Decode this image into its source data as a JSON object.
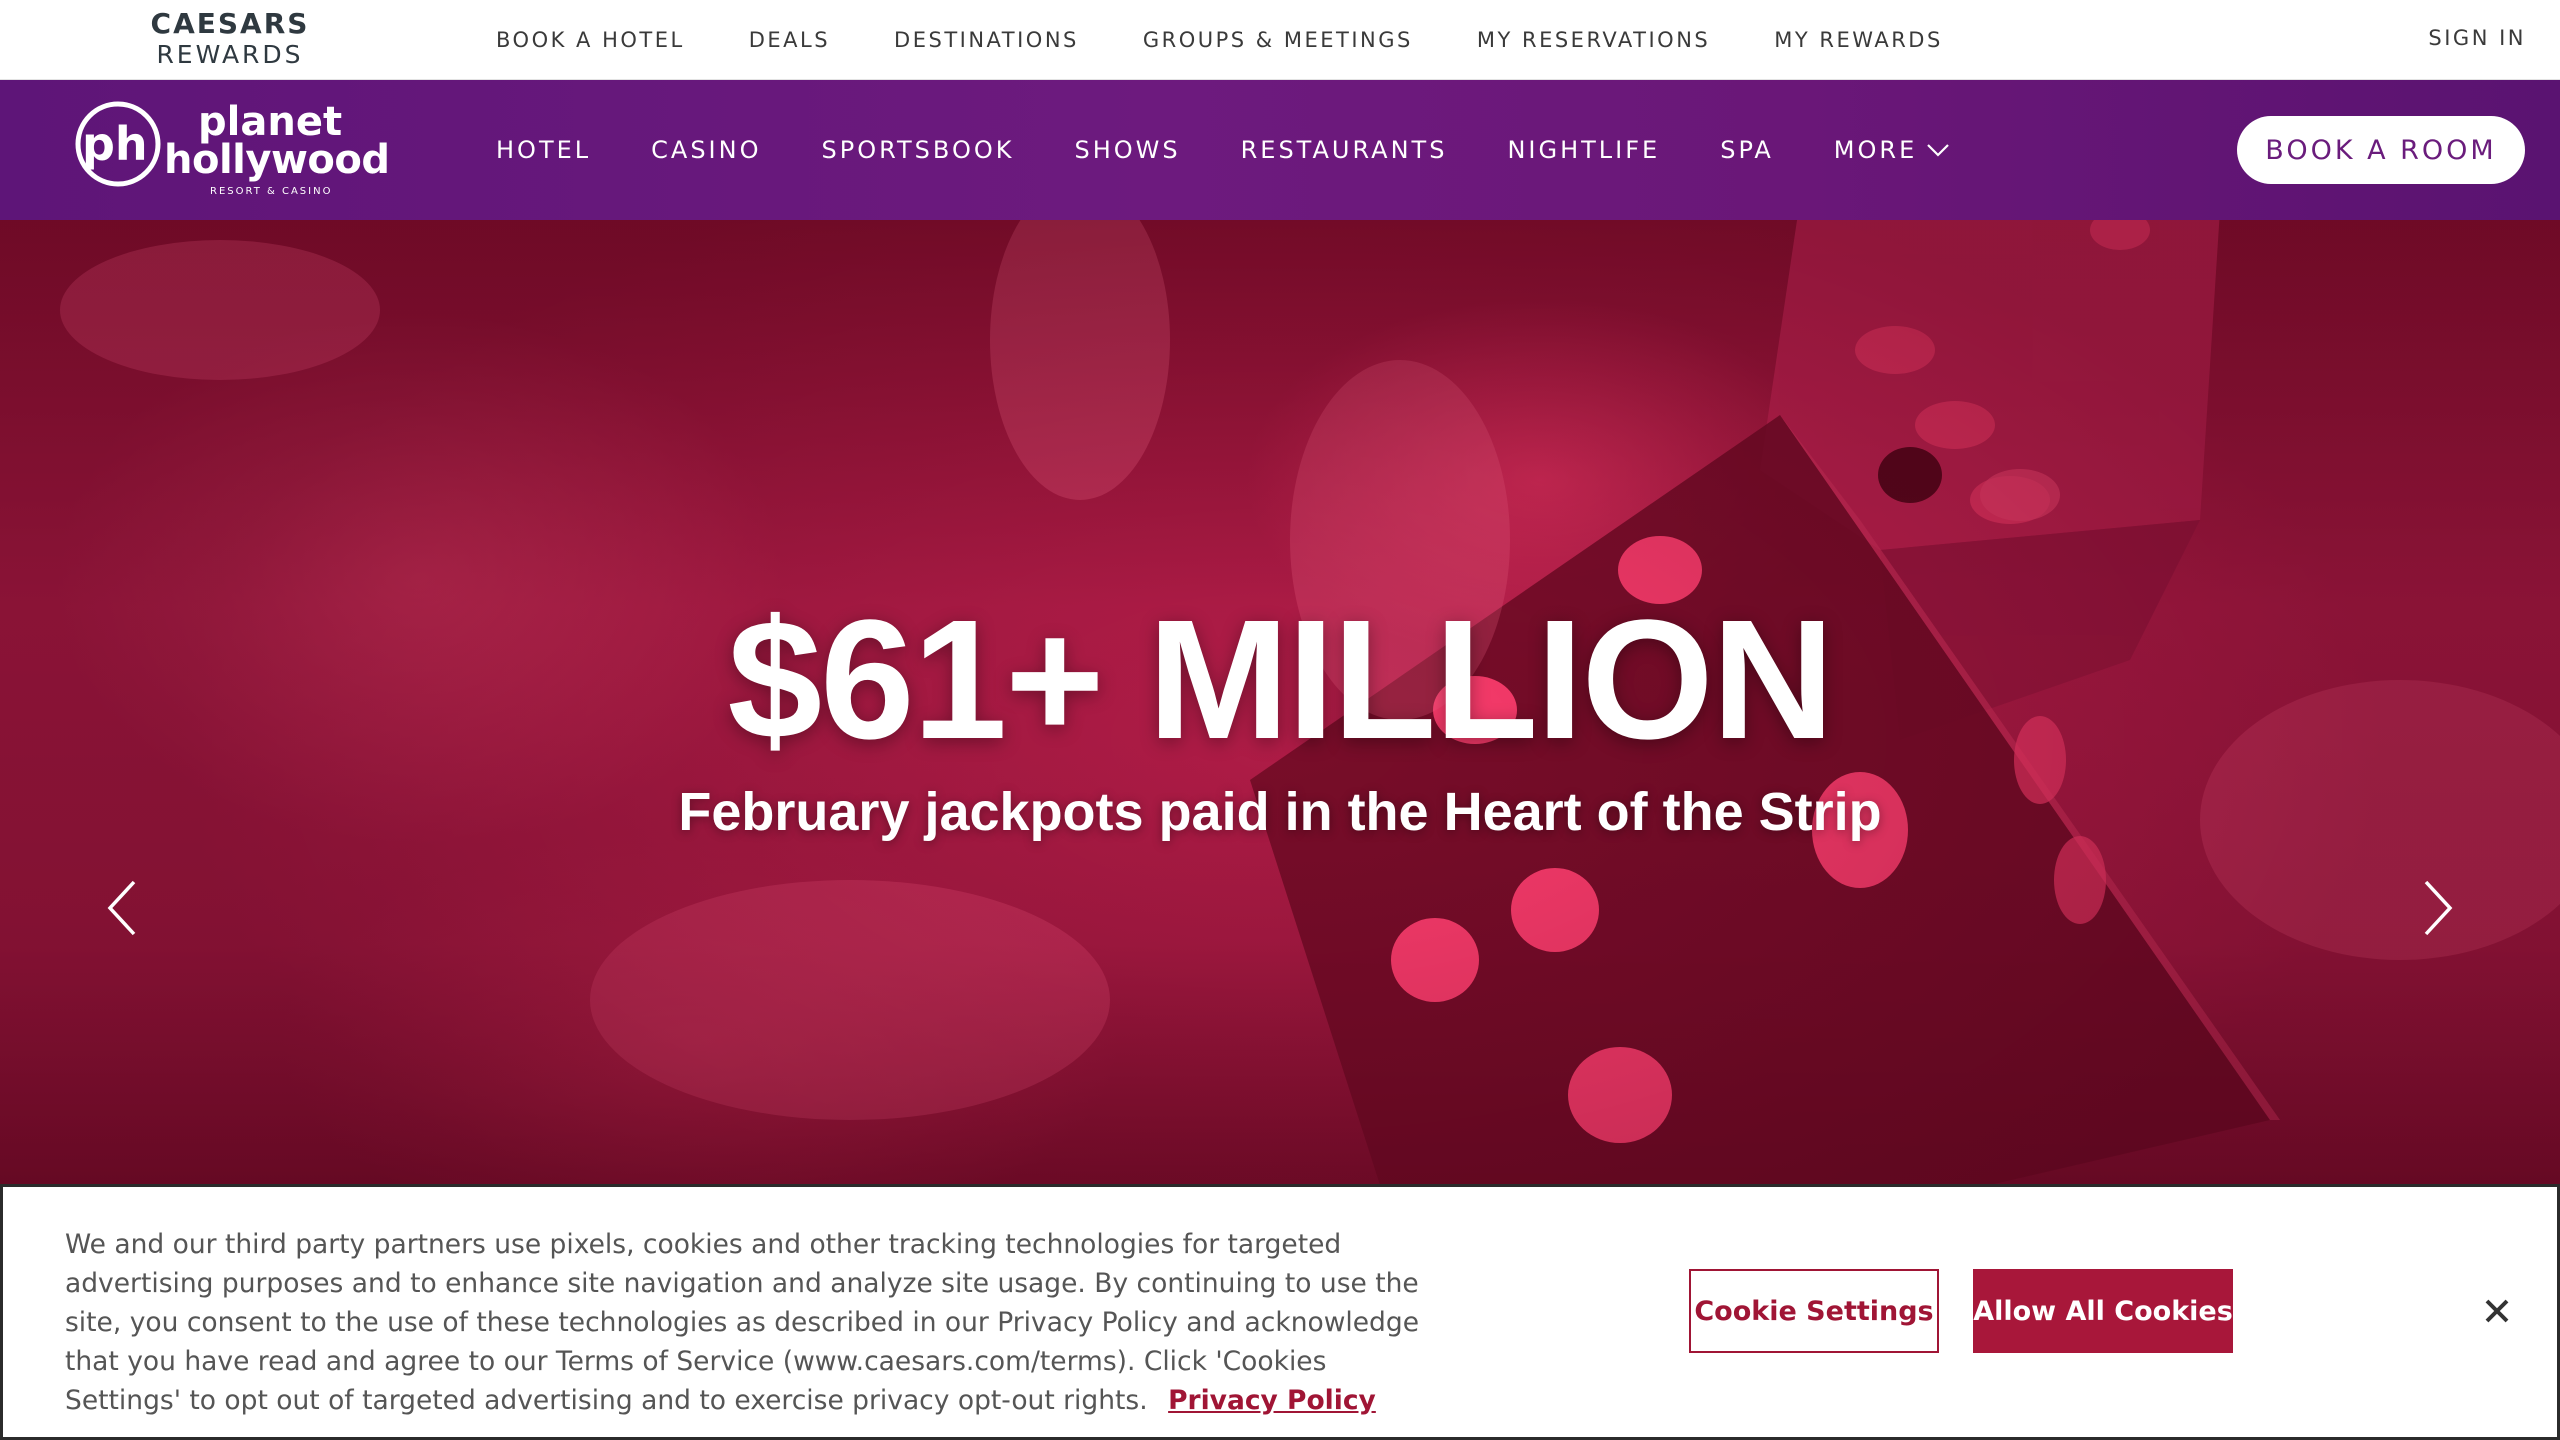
{
  "brand_bar": {
    "logo_line1": "CAESARS",
    "logo_line2": "REWARDS",
    "nav": [
      "BOOK A HOTEL",
      "DEALS",
      "DESTINATIONS",
      "GROUPS & MEETINGS",
      "MY RESERVATIONS",
      "MY REWARDS"
    ],
    "sign_in": "SIGN IN"
  },
  "property_bar": {
    "logo_word1": "planet",
    "logo_word2": "hollywood",
    "logo_tagline": "RESORT & CASINO",
    "nav": [
      "HOTEL",
      "CASINO",
      "SPORTSBOOK",
      "SHOWS",
      "RESTAURANTS",
      "NIGHTLIFE",
      "SPA"
    ],
    "more_label": "MORE",
    "more_icon": "chevron-down-icon",
    "book_button": "BOOK A ROOM"
  },
  "hero": {
    "headline": "$61+ MILLION",
    "subheadline": "February jackpots paid in the Heart of the Strip",
    "prev_icon": "chevron-left-icon",
    "next_icon": "chevron-right-icon"
  },
  "cookie_banner": {
    "text": "We and our third party partners use pixels, cookies and other tracking technologies for targeted advertising purposes and to enhance site navigation and analyze site usage. By continuing to use the site, you consent to the use of these technologies as described in our Privacy Policy and acknowledge that you have read and agree to our Terms of Service (www.caesars.com/terms). Click 'Cookies Settings' to opt out of targeted advertising and to exercise privacy opt-out rights.",
    "privacy_link": "Privacy Policy",
    "settings_button": "Cookie Settings",
    "allow_button": "Allow All Cookies",
    "close_icon": "close-icon"
  },
  "colors": {
    "purple_bar": "#6a1778",
    "accent_red": "#a8173a",
    "hero_base": "#b41d49"
  }
}
